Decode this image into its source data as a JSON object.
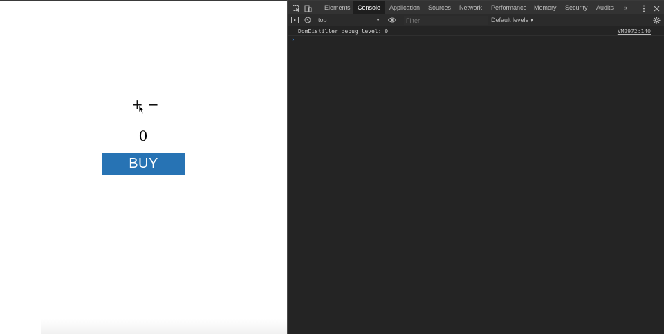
{
  "page": {
    "plus_label": "+",
    "minus_label": "−",
    "quantity": "0",
    "buy_label": "BUY",
    "buy_color": "#2773b4"
  },
  "devtools": {
    "tabs": [
      {
        "label": "Elements",
        "active": false
      },
      {
        "label": "Console",
        "active": true
      },
      {
        "label": "Application",
        "active": false
      },
      {
        "label": "Sources",
        "active": false
      },
      {
        "label": "Network",
        "active": false
      },
      {
        "label": "Performance",
        "active": false
      },
      {
        "label": "Memory",
        "active": false
      },
      {
        "label": "Security",
        "active": false
      },
      {
        "label": "Audits",
        "active": false
      }
    ],
    "overflow_label": "»",
    "toolbar": {
      "context": "top",
      "filter_placeholder": "Filter",
      "levels": "Default levels ▾"
    },
    "console": {
      "messages": [
        {
          "text": "DomDistiller debug level: 0",
          "source": "VM2972:140"
        }
      ],
      "prompt": "›"
    },
    "icons": [
      "inspect-icon",
      "device-toggle-icon",
      "kebab-menu-icon",
      "close-icon",
      "sidebar-icon",
      "clear-console-icon",
      "eye-icon",
      "gear-icon"
    ]
  }
}
